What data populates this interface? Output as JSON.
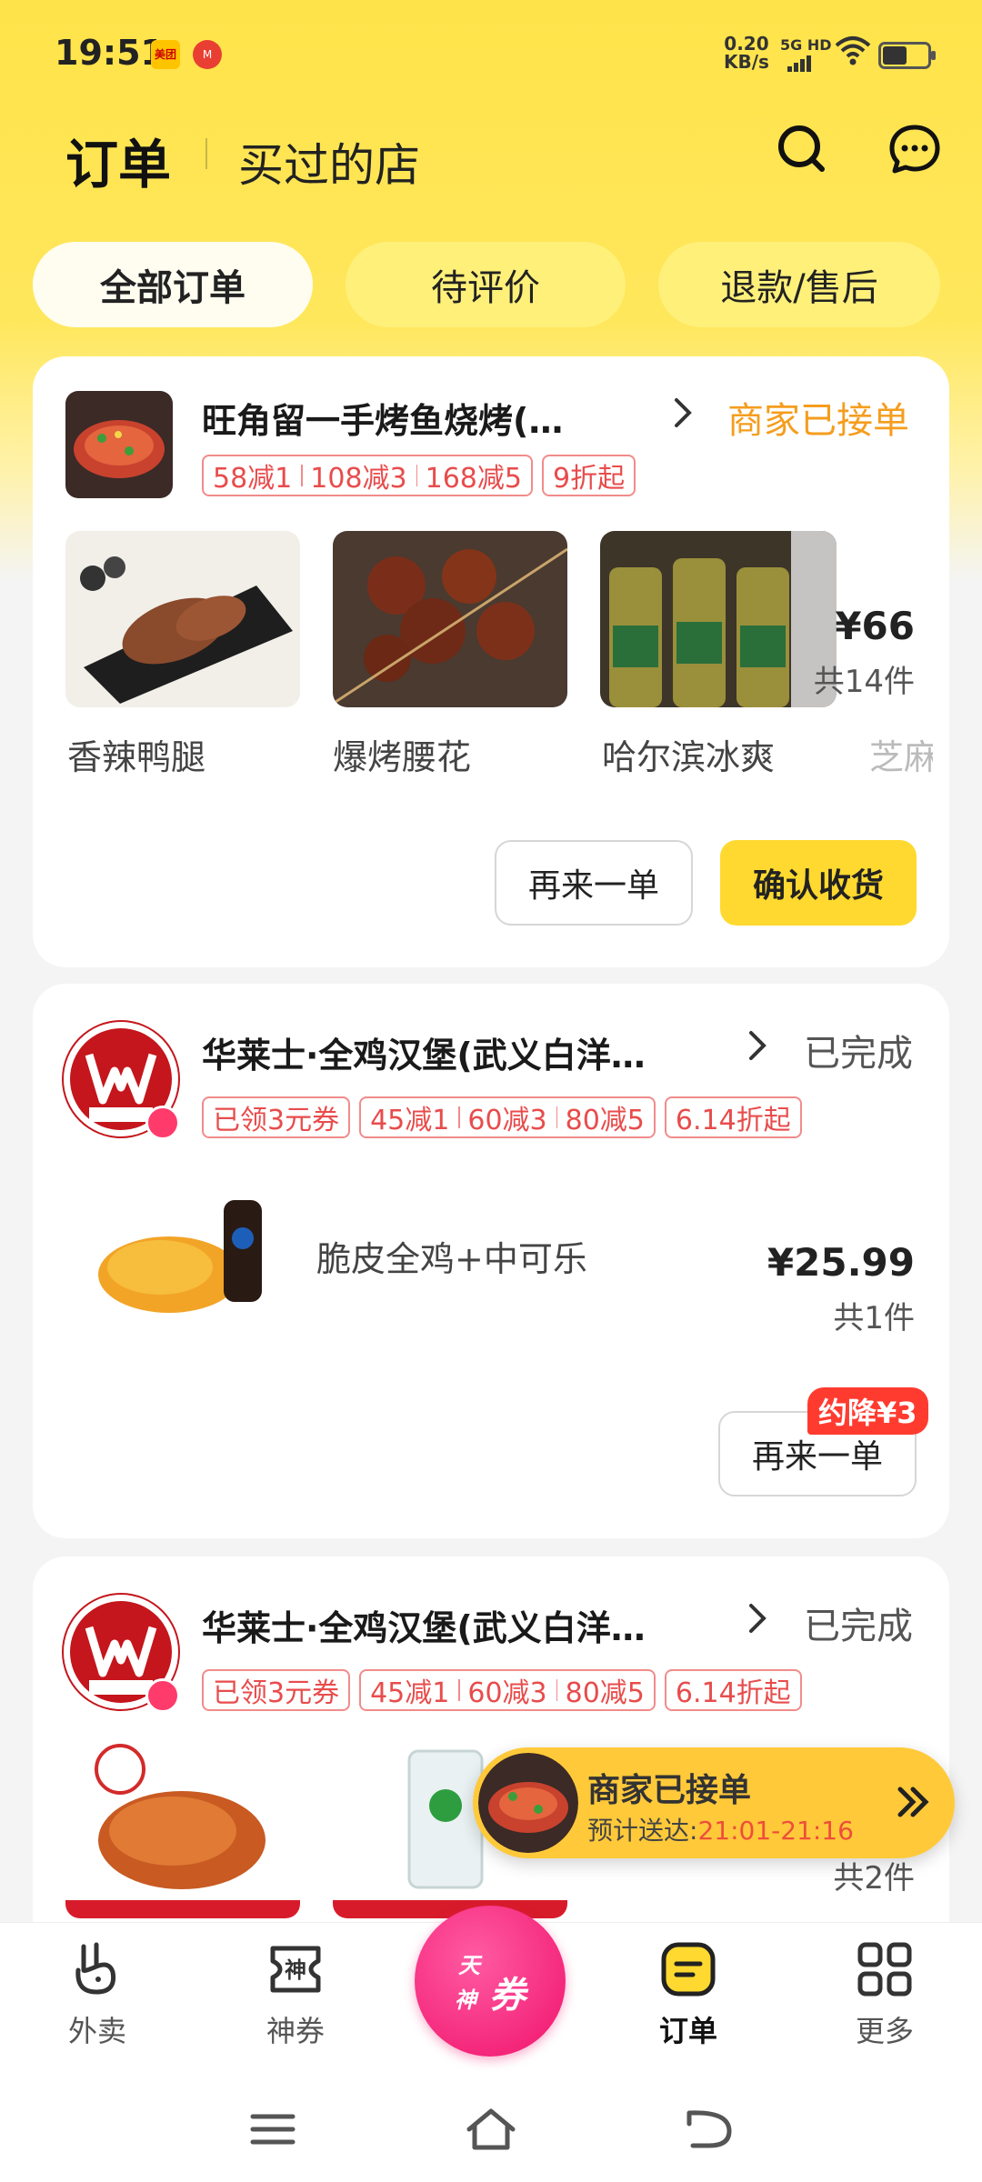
{
  "status_bar": {
    "time": "19:51",
    "app_logo1": "美团",
    "app_logo2": "M",
    "net_speed_value": "0.20",
    "net_speed_unit": "KB/s",
    "signal_label": "5G HD"
  },
  "header": {
    "title": "订单",
    "tab2": "买过的店"
  },
  "filters": [
    "全部订单",
    "待评价",
    "退款/售后"
  ],
  "orders": [
    {
      "store_name": "旺角留一手烤鱼烧烤(…",
      "status": "商家已接单",
      "promos": [
        [
          "58减1",
          "108减3",
          "168减5"
        ],
        [
          "9折起"
        ]
      ],
      "items": [
        "香辣鸭腿",
        "爆烤腰花",
        "哈尔滨冰爽",
        "芝麻"
      ],
      "price": "¥66",
      "count": "共14件",
      "buttons": [
        "再来一单",
        "确认收货"
      ]
    },
    {
      "store_name": "华莱士·全鸡汉堡(武义白洋…",
      "status": "已完成",
      "promos": [
        [
          "已领3元券"
        ],
        [
          "45减1",
          "60减3",
          "80减5"
        ],
        [
          "6.14折起"
        ]
      ],
      "item": "脆皮全鸡+中可乐",
      "price": "¥25.99",
      "count": "共1件",
      "badge": "约降¥3",
      "button": "再来一单"
    },
    {
      "store_name": "华莱士·全鸡汉堡(武义白洋…",
      "status": "已完成",
      "promos": [
        [
          "已领3元券"
        ],
        [
          "45减1",
          "60减3",
          "80减5"
        ],
        [
          "6.14折起"
        ]
      ],
      "count": "共2件"
    }
  ],
  "float_banner": {
    "title": "商家已接单",
    "eta_label": "预计送达:",
    "eta_time": "21:01-21:16"
  },
  "bottom_nav": {
    "items": [
      "外卖",
      "神券",
      "订单",
      "更多"
    ],
    "center": {
      "line1": "天",
      "line2": "神",
      "main": "券"
    }
  },
  "colors": {
    "brand_yellow": "#ffd92f",
    "accent_orange": "#f59d1e",
    "promo_red": "#e84c4c",
    "coupon_pink": "#f0136b"
  }
}
